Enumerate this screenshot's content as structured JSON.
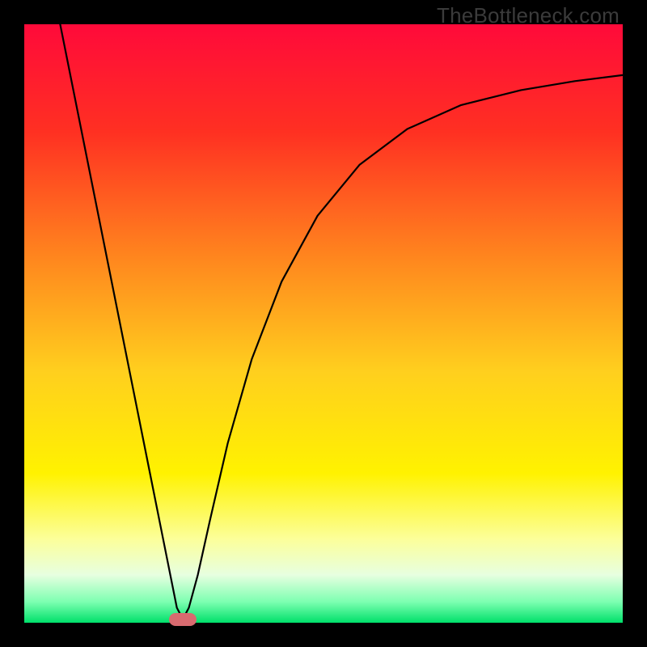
{
  "watermark": "TheBottleneck.com",
  "chart_data": {
    "type": "line",
    "title": "",
    "xlabel": "",
    "ylabel": "",
    "xlim": [
      0,
      100
    ],
    "ylim": [
      0,
      100
    ],
    "grid": false,
    "legend": false,
    "gradient_stops": [
      {
        "offset": 0.0,
        "color": "#ff0a3a"
      },
      {
        "offset": 0.18,
        "color": "#ff3022"
      },
      {
        "offset": 0.4,
        "color": "#ff8a1e"
      },
      {
        "offset": 0.58,
        "color": "#ffcf1e"
      },
      {
        "offset": 0.75,
        "color": "#fff200"
      },
      {
        "offset": 0.86,
        "color": "#fcff9a"
      },
      {
        "offset": 0.92,
        "color": "#e7ffe0"
      },
      {
        "offset": 0.965,
        "color": "#7dffb1"
      },
      {
        "offset": 1.0,
        "color": "#00e06a"
      }
    ],
    "curve_points": [
      {
        "x": 6.0,
        "y": 100.0
      },
      {
        "x": 8.0,
        "y": 90.0
      },
      {
        "x": 10.0,
        "y": 80.0
      },
      {
        "x": 12.0,
        "y": 70.0
      },
      {
        "x": 14.0,
        "y": 60.0
      },
      {
        "x": 16.0,
        "y": 50.0
      },
      {
        "x": 18.0,
        "y": 40.0
      },
      {
        "x": 20.0,
        "y": 30.0
      },
      {
        "x": 22.0,
        "y": 20.0
      },
      {
        "x": 24.0,
        "y": 10.0
      },
      {
        "x": 25.5,
        "y": 2.5
      },
      {
        "x": 26.5,
        "y": 0.6
      },
      {
        "x": 27.5,
        "y": 2.5
      },
      {
        "x": 29.0,
        "y": 8.0
      },
      {
        "x": 31.0,
        "y": 17.0
      },
      {
        "x": 34.0,
        "y": 30.0
      },
      {
        "x": 38.0,
        "y": 44.0
      },
      {
        "x": 43.0,
        "y": 57.0
      },
      {
        "x": 49.0,
        "y": 68.0
      },
      {
        "x": 56.0,
        "y": 76.5
      },
      {
        "x": 64.0,
        "y": 82.5
      },
      {
        "x": 73.0,
        "y": 86.5
      },
      {
        "x": 83.0,
        "y": 89.0
      },
      {
        "x": 92.0,
        "y": 90.5
      },
      {
        "x": 100.0,
        "y": 91.5
      }
    ],
    "marker": {
      "x": 26.5,
      "y": 0.6,
      "color": "#d86a6f"
    }
  }
}
